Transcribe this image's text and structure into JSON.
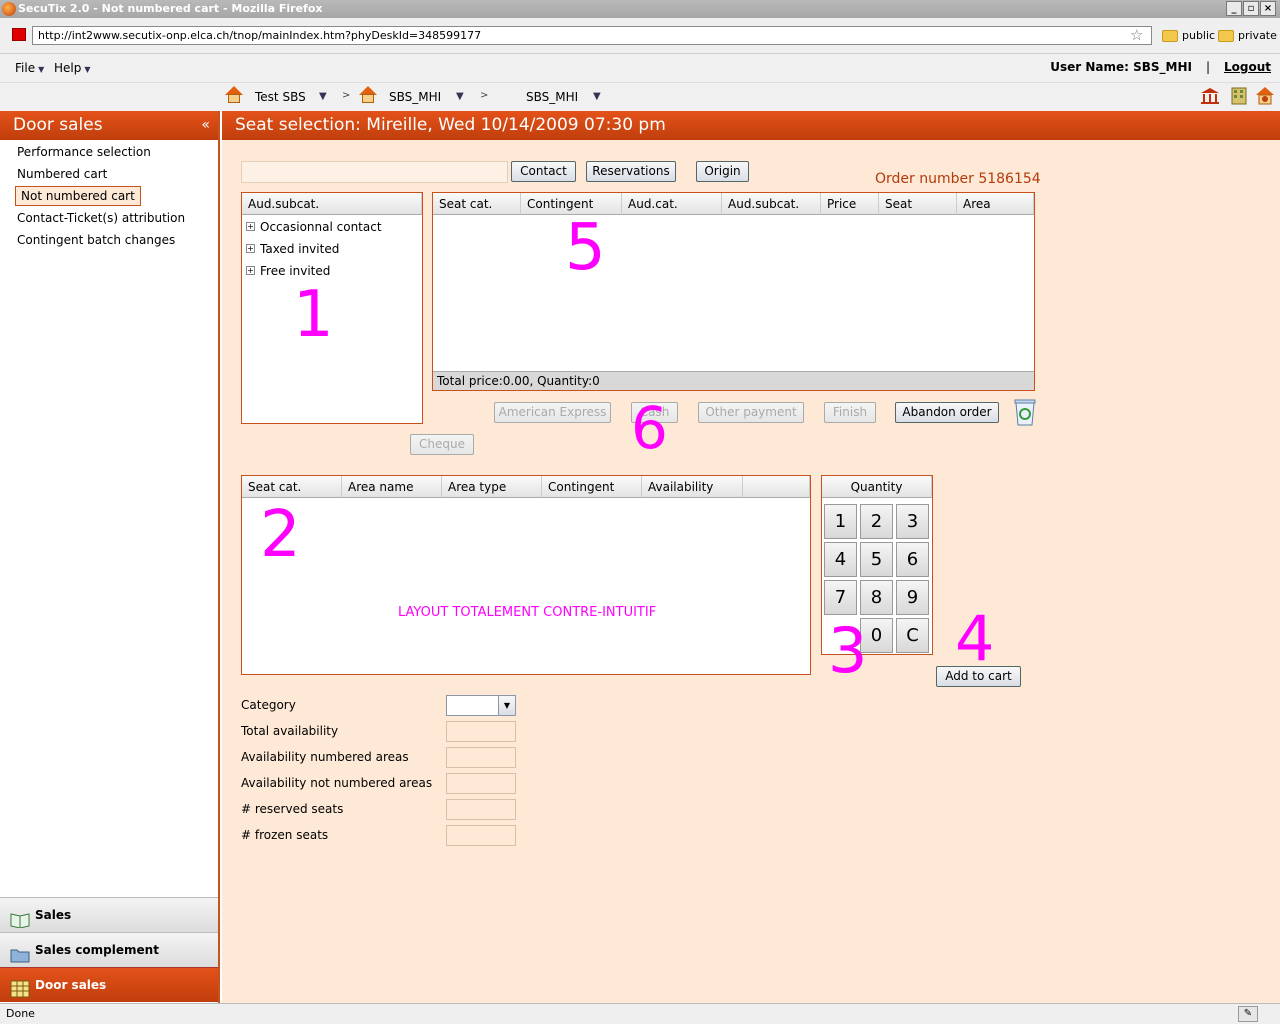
{
  "window": {
    "title": "SecuTix 2.0 - Not numbered cart - Mozilla Firefox"
  },
  "browser": {
    "url": "http://int2www.secutix-onp.elca.ch/tnop/mainIndex.htm?phyDeskId=348599177",
    "bookmarks": [
      "public",
      "private"
    ],
    "status": "Done"
  },
  "menubar": {
    "file": "File",
    "help": "Help",
    "username": "User Name: SBS_MHI",
    "separator": "|",
    "logout": "Logout"
  },
  "context": {
    "org": "Test SBS",
    "unit": "SBS_MHI",
    "desk": "SBS_MHI",
    "gt": ">"
  },
  "sidebar": {
    "title": "Door sales",
    "collapse": "«",
    "links": [
      "Performance selection",
      "Numbered cart",
      "Not numbered cart",
      "Contact-Ticket(s) attribution",
      "Contingent batch changes"
    ],
    "tabs": [
      "Sales",
      "Sales complement",
      "Door sales"
    ]
  },
  "main": {
    "title": "Seat selection: Mireille, Wed 10/14/2009 07:30 pm",
    "contact_input_value": "",
    "buttons": {
      "contact": "Contact",
      "reservations": "Reservations",
      "origin": "Origin",
      "amex": "American Express",
      "cash": "Cash",
      "other_payment": "Other payment",
      "finish": "Finish",
      "abandon": "Abandon order",
      "cheque": "Cheque",
      "add_to_cart": "Add to cart"
    },
    "order_number": "Order number 5186154",
    "audience_panel": {
      "header": "Aud.subcat.",
      "items": [
        "Occasionnal contact",
        "Taxed invited",
        "Free invited"
      ],
      "expand_glyph": "+"
    },
    "cart_table": {
      "columns": [
        "Seat cat.",
        "Contingent",
        "Aud.cat.",
        "Aud.subcat.",
        "Price",
        "Seat",
        "Area"
      ],
      "footer": "Total price:0.00, Quantity:0"
    },
    "avail_table": {
      "columns": [
        "Seat cat.",
        "Area name",
        "Area type",
        "Contingent",
        "Availability"
      ]
    },
    "keypad": {
      "title": "Quantity",
      "keys": [
        "1",
        "2",
        "3",
        "4",
        "5",
        "6",
        "7",
        "8",
        "9",
        "0",
        "C"
      ]
    },
    "form": {
      "labels": [
        "Category",
        "Total availability",
        "Availability numbered areas",
        "Availability not numbered areas",
        "# reserved seats",
        "# frozen seats"
      ],
      "category_value": ""
    }
  },
  "annotations": {
    "n1": "1",
    "n2": "2",
    "n3": "3",
    "n4": "4",
    "n5": "5",
    "n6": "6",
    "note": "LAYOUT TOTALEMENT CONTRE-INTUITIF"
  },
  "colors": {
    "accent": "#c03e0c",
    "panel_bg": "#fde9d6",
    "annotation": "#ff00ff"
  }
}
